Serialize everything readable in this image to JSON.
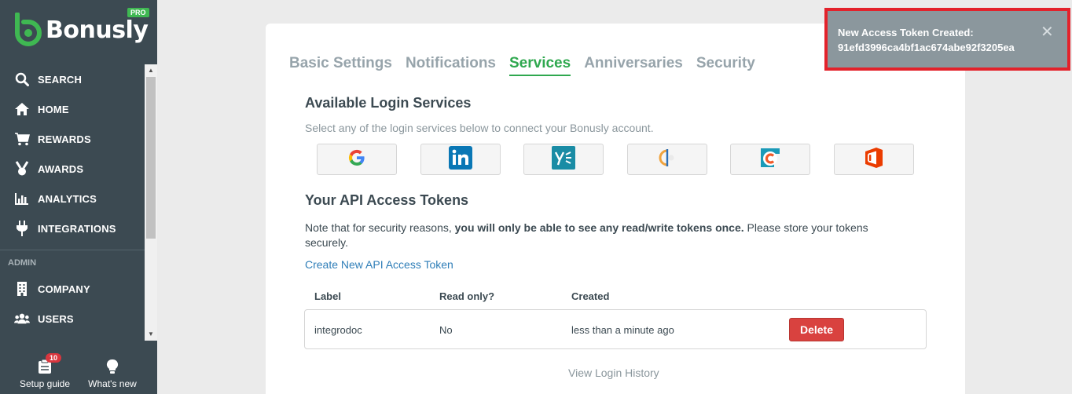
{
  "brand": {
    "name": "Bonusly",
    "badge": "PRO",
    "accent": "#2fa84f"
  },
  "sidebar": {
    "items": [
      {
        "label": "SEARCH",
        "icon": "search-icon"
      },
      {
        "label": "HOME",
        "icon": "home-icon"
      },
      {
        "label": "REWARDS",
        "icon": "cart-icon"
      },
      {
        "label": "AWARDS",
        "icon": "medal-icon"
      },
      {
        "label": "ANALYTICS",
        "icon": "bar-chart-icon"
      },
      {
        "label": "INTEGRATIONS",
        "icon": "plug-icon"
      }
    ],
    "admin_section": "ADMIN",
    "admin_items": [
      {
        "label": "COMPANY",
        "icon": "building-icon"
      },
      {
        "label": "USERS",
        "icon": "users-icon"
      }
    ],
    "bottom": {
      "setup_label": "Setup guide",
      "setup_badge": "10",
      "whats_new_label": "What's new"
    }
  },
  "tabs": [
    {
      "label": "Basic Settings",
      "active": false
    },
    {
      "label": "Notifications",
      "active": false
    },
    {
      "label": "Services",
      "active": true
    },
    {
      "label": "Anniversaries",
      "active": false
    },
    {
      "label": "Security",
      "active": false
    }
  ],
  "login_services": {
    "title": "Available Login Services",
    "description": "Select any of the login services below to connect your Bonusly account.",
    "providers": [
      "google-icon",
      "linkedin-icon",
      "yammer-icon",
      "okta-icon",
      "ceridian-icon",
      "office365-icon"
    ]
  },
  "api_tokens": {
    "title": "Your API Access Tokens",
    "note_before": "Note that for security reasons, ",
    "note_bold": "you will only be able to see any read/write tokens once.",
    "note_after": " Please store your tokens securely.",
    "create_link": "Create New API Access Token",
    "columns": {
      "label": "Label",
      "read_only": "Read only?",
      "created": "Created"
    },
    "rows": [
      {
        "label": "integrodoc",
        "read_only": "No",
        "created": "less than a minute ago",
        "action": "Delete"
      }
    ],
    "history_link": "View Login History"
  },
  "toast": {
    "title": "New Access Token Created:",
    "token": "91efd3996ca4bf1ac674abe92f3205ea"
  }
}
